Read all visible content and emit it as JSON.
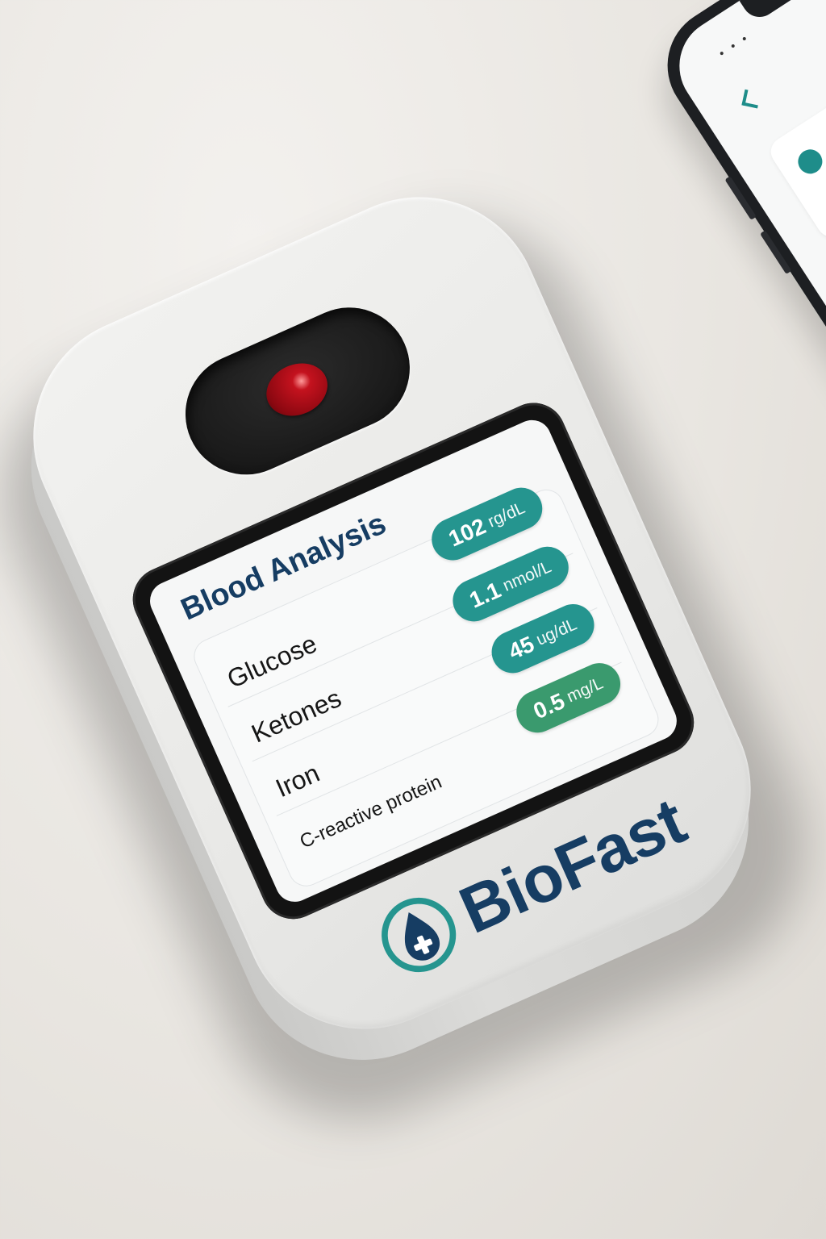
{
  "device": {
    "brand_name": "BioFast",
    "logo_icon": "blood-drop-plus-icon",
    "accent_color": "#25958f",
    "brand_color": "#163d63",
    "sample_color": "#b0101b"
  },
  "screen": {
    "title": "Blood Analysis",
    "results": [
      {
        "name": "Glucose",
        "value": "102",
        "unit": "rg/dL"
      },
      {
        "name": "Ketones",
        "value": "1.1",
        "unit": "nmol/L"
      },
      {
        "name": "Iron",
        "value": "45",
        "unit": "ug/dL"
      },
      {
        "name": "C-reactive protein",
        "value": "0.5",
        "unit": "mg/L"
      }
    ]
  },
  "phone": {
    "signal_glyph": "• • •",
    "back_icon": "chevron-left-icon",
    "card_icon": "status-circle-icon"
  }
}
